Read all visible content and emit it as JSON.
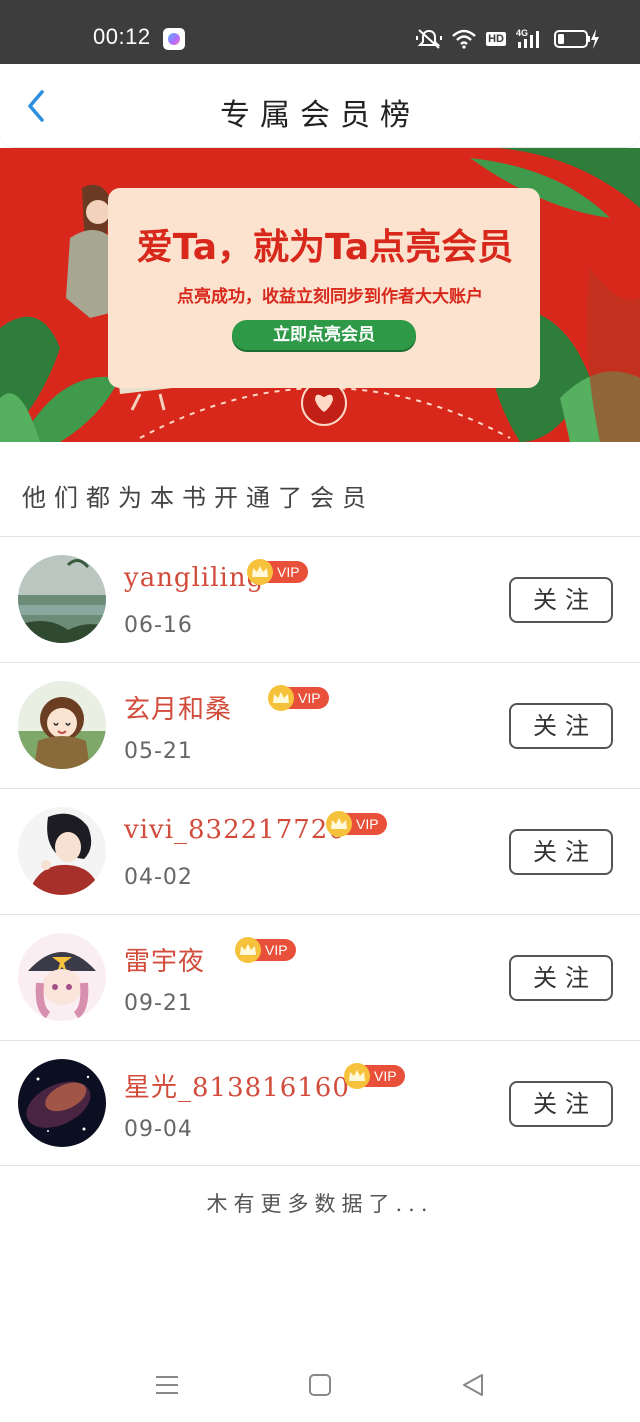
{
  "status_bar": {
    "time": "00:12",
    "icons": [
      "app-icon",
      "mute-icon",
      "wifi-icon",
      "hd-icon",
      "signal-4g-icon",
      "battery-charging-icon"
    ],
    "hd_label": "HD"
  },
  "header": {
    "title": "专属会员榜",
    "back_icon": "chevron-left-icon"
  },
  "banner": {
    "title": "爱Ta，就为Ta点亮会员",
    "subtitle": "点亮成功，收益立刻同步到作者大大账户",
    "cta_label": "立即点亮会员"
  },
  "section_title": "他们都为本书开通了会员",
  "members": [
    {
      "name": "yangliling",
      "vip_label": "VIP",
      "date": "06-16",
      "follow_label": "关注"
    },
    {
      "name": "玄月和桑",
      "vip_label": "VIP",
      "date": "05-21",
      "follow_label": "关注"
    },
    {
      "name": "vivi_832217720",
      "vip_label": "VIP",
      "date": "04-02",
      "follow_label": "关注"
    },
    {
      "name": "雷宇夜",
      "vip_label": "VIP",
      "date": "09-21",
      "follow_label": "关注"
    },
    {
      "name": "星光_813816160",
      "vip_label": "VIP",
      "date": "09-04",
      "follow_label": "关注"
    }
  ],
  "end_text": "木有更多数据了...",
  "colors": {
    "accent_blue": "#2b8fe0",
    "banner_red": "#d8281c",
    "name_red": "#d24c3c",
    "vip_gold": "#f6c23b",
    "cta_green": "#2e9a48"
  },
  "nav_bar": {
    "icons": [
      "menu-icon",
      "home-square-icon",
      "back-triangle-icon"
    ]
  }
}
